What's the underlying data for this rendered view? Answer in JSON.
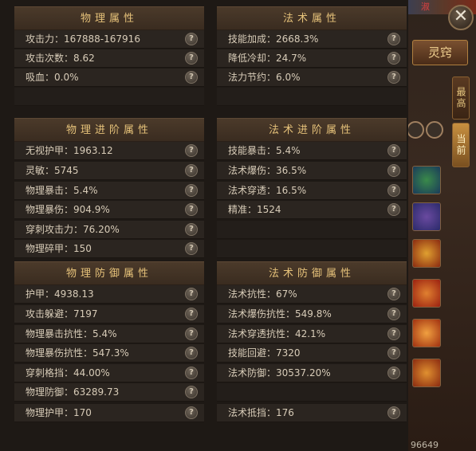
{
  "sections": {
    "phys": {
      "title": "物理属性",
      "rows": [
        {
          "label": "攻击力：167888-167916"
        },
        {
          "label": "攻击次数：8.62"
        },
        {
          "label": "吸血：0.0%"
        }
      ]
    },
    "magic": {
      "title": "法术属性",
      "rows": [
        {
          "label": "技能加成：2668.3%"
        },
        {
          "label": "降低冷却：24.7%"
        },
        {
          "label": "法力节约：6.0%"
        }
      ]
    },
    "phys_adv": {
      "title": "物理进阶属性",
      "rows": [
        {
          "label": "无视护甲：1963.12"
        },
        {
          "label": "灵敏：5745"
        },
        {
          "label": "物理暴击：5.4%"
        },
        {
          "label": "物理暴伤：904.9%"
        },
        {
          "label": "穿刺攻击力：76.20%"
        },
        {
          "label": "物理碎甲：150"
        }
      ]
    },
    "magic_adv": {
      "title": "法术进阶属性",
      "rows": [
        {
          "label": "技能暴击：5.4%"
        },
        {
          "label": "法术爆伤：36.5%"
        },
        {
          "label": "法术穿透：16.5%"
        },
        {
          "label": "精准：1524"
        }
      ]
    },
    "phys_def": {
      "title": "物理防御属性",
      "rows": [
        {
          "label": "护甲：4938.13"
        },
        {
          "label": "攻击躲避：7197"
        },
        {
          "label": "物理暴击抗性：5.4%"
        },
        {
          "label": "物理暴伤抗性：547.3%"
        },
        {
          "label": "穿刺格挡：44.00%"
        },
        {
          "label": "物理防御：63289.73"
        },
        {
          "label": "物理护甲：170"
        }
      ]
    },
    "magic_def": {
      "title": "法术防御属性",
      "rows": [
        {
          "label": "法术抗性：67%"
        },
        {
          "label": "法术爆伤抗性：549.8%"
        },
        {
          "label": "法术穿透抗性：42.1%"
        },
        {
          "label": "技能回避：7320"
        },
        {
          "label": "法术防御：30537.20%"
        },
        {
          "label": "法术抵挡：176"
        }
      ]
    }
  },
  "help_glyph": "?",
  "right_ui": {
    "close_glyph": "✕",
    "lingqiao_label": "灵窍",
    "tab_top_label": "最高",
    "tab_current_label": "当前",
    "top_red_text": "淑",
    "bottom_number": "96649"
  }
}
